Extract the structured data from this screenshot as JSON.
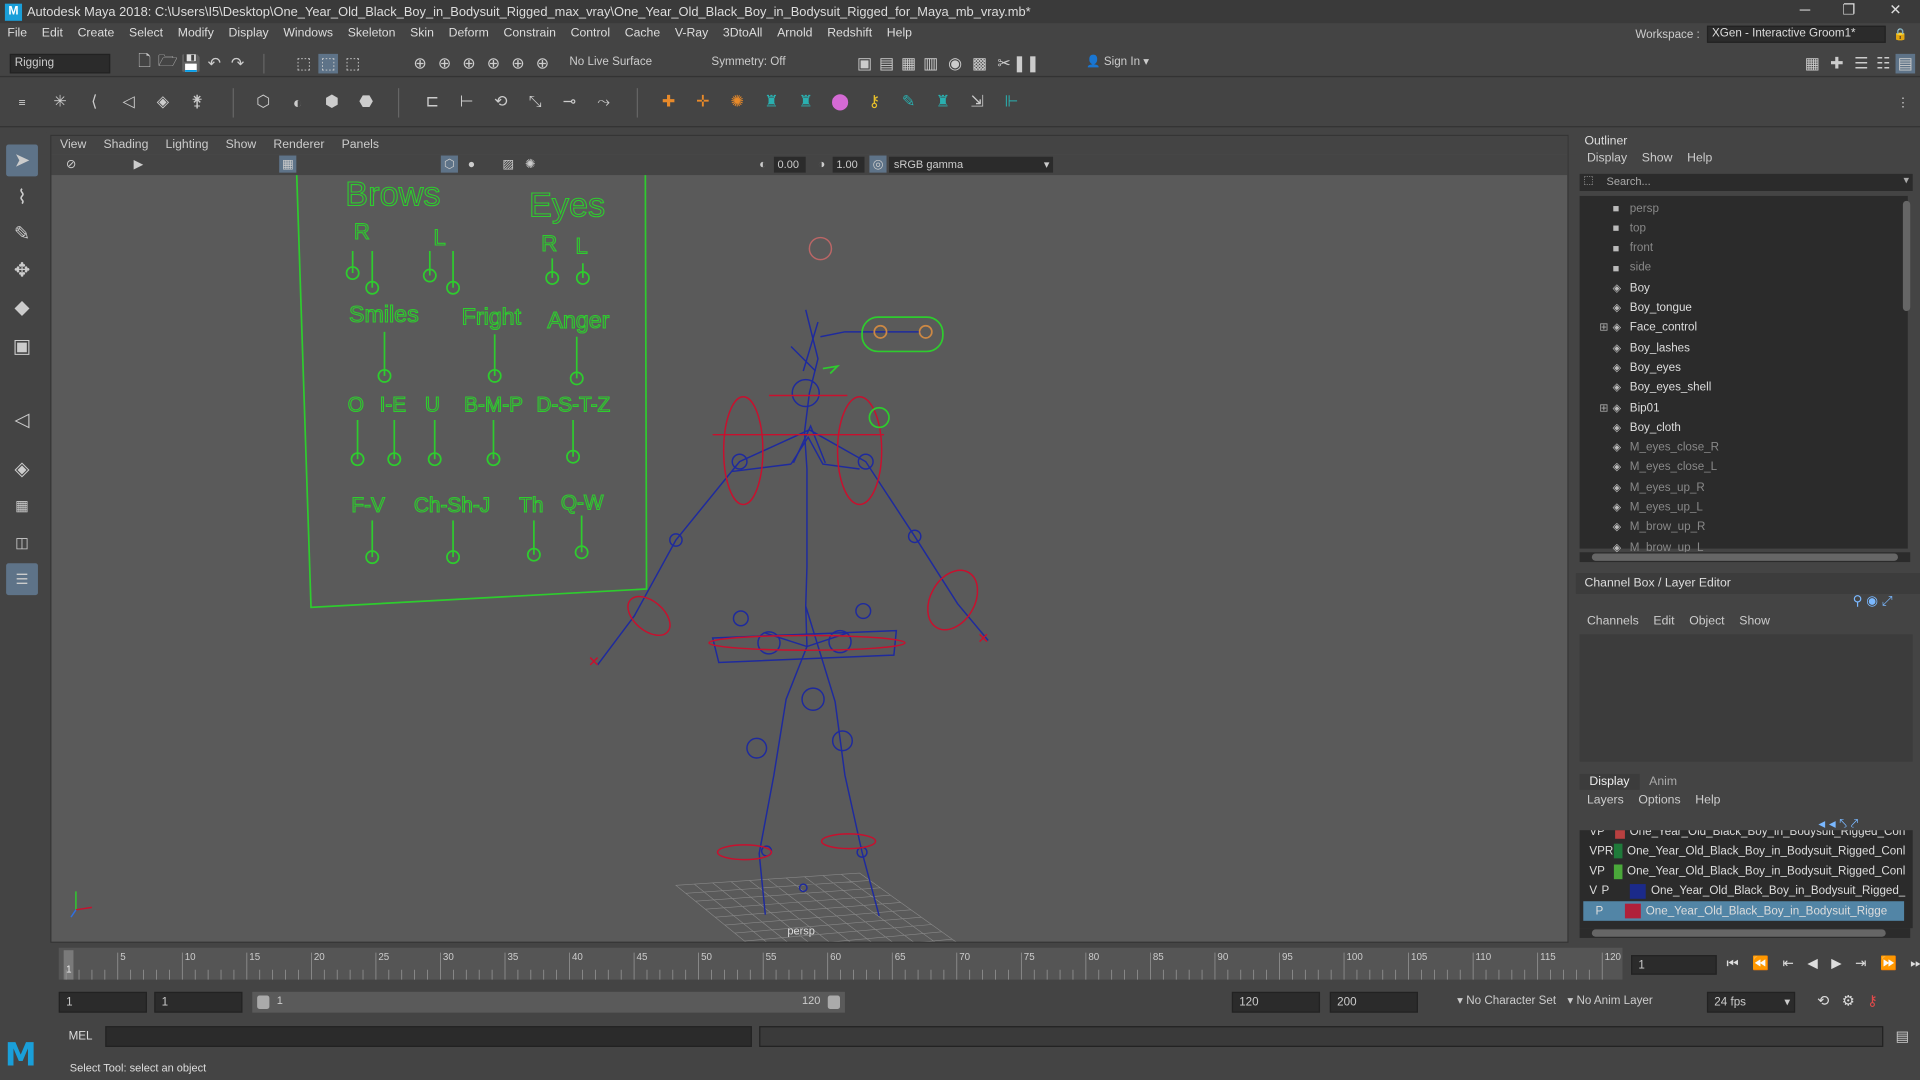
{
  "title": "Autodesk Maya 2018: C:\\Users\\I5\\Desktop\\One_Year_Old_Black_Boy_in_Bodysuit_Rigged_max_vray\\One_Year_Old_Black_Boy_in_Bodysuit_Rigged_for_Maya_mb_vray.mb*",
  "menus": [
    "File",
    "Edit",
    "Create",
    "Select",
    "Modify",
    "Display",
    "Windows",
    "Skeleton",
    "Skin",
    "Deform",
    "Constrain",
    "Control",
    "Cache",
    "V-Ray",
    "3DtoAll",
    "Arnold",
    "Redshift",
    "Help"
  ],
  "workspace": {
    "label": "Workspace :",
    "value": "XGen - Interactive Groom1*"
  },
  "status": {
    "menuset": "Rigging",
    "live": "No Live Surface",
    "symmetry": "Symmetry: Off",
    "signin": "Sign In"
  },
  "viewport": {
    "menus": [
      "View",
      "Shading",
      "Lighting",
      "Show",
      "Renderer",
      "Panels"
    ],
    "exposure": "0.00",
    "gamma": "1.00",
    "colorspace": "sRGB gamma",
    "camera": "persp",
    "board": {
      "brows": "Brows",
      "eyes": "Eyes",
      "r": "R",
      "l": "L",
      "smiles": "Smiles",
      "fright": "Fright",
      "anger": "Anger",
      "o": "O",
      "ie": "I-E",
      "u": "U",
      "bmp": "B-M-P",
      "dstz": "D-S-T-Z",
      "fv": "F-V",
      "chshj": "Ch-Sh-J",
      "th": "Th",
      "qw": "Q-W"
    }
  },
  "outliner": {
    "title": "Outliner",
    "menus": [
      "Display",
      "Show",
      "Help"
    ],
    "search": "Search...",
    "items": [
      {
        "label": "persp",
        "dim": true,
        "cam": true
      },
      {
        "label": "top",
        "dim": true,
        "cam": true
      },
      {
        "label": "front",
        "dim": true,
        "cam": true
      },
      {
        "label": "side",
        "dim": true,
        "cam": true
      },
      {
        "label": "Boy",
        "dim": false
      },
      {
        "label": "Boy_tongue",
        "dim": false
      },
      {
        "label": "Face_control",
        "dim": false,
        "exp": true
      },
      {
        "label": "Boy_lashes",
        "dim": false
      },
      {
        "label": "Boy_eyes",
        "dim": false
      },
      {
        "label": "Boy_eyes_shell",
        "dim": false
      },
      {
        "label": "Bip01",
        "dim": false,
        "exp": true
      },
      {
        "label": "Boy_cloth",
        "dim": false
      },
      {
        "label": "M_eyes_close_R",
        "dim": true
      },
      {
        "label": "M_eyes_close_L",
        "dim": true
      },
      {
        "label": "M_eyes_up_R",
        "dim": true
      },
      {
        "label": "M_eyes_up_L",
        "dim": true
      },
      {
        "label": "M_brow_up_R",
        "dim": true
      },
      {
        "label": "M_brow_up_L",
        "dim": true
      }
    ]
  },
  "channelbox": {
    "title": "Channel Box / Layer Editor",
    "menus": [
      "Channels",
      "Edit",
      "Object",
      "Show"
    ]
  },
  "layers": {
    "tabs": [
      "Display",
      "Anim"
    ],
    "menus": [
      "Layers",
      "Options",
      "Help"
    ],
    "rows": [
      {
        "v": "V",
        "p": "P",
        "r": "",
        "color": "#b84040",
        "name": "One_Year_Old_Black_Boy_in_Bodysuit_Rigged_Con"
      },
      {
        "v": "V",
        "p": "P",
        "r": "R",
        "color": "#1f7a3a",
        "name": "One_Year_Old_Black_Boy_in_Bodysuit_Rigged_Conl"
      },
      {
        "v": "V",
        "p": "P",
        "r": "",
        "color": "#4aa83a",
        "name": "One_Year_Old_Black_Boy_in_Bodysuit_Rigged_Conl"
      },
      {
        "v": "V",
        "p": "P",
        "r": "",
        "color": "#1b2a8a",
        "name": "One_Year_Old_Black_Boy_in_Bodysuit_Rigged_"
      },
      {
        "v": "",
        "p": "P",
        "r": "",
        "color": "#b0203a",
        "name": "One_Year_Old_Black_Boy_in_Bodysuit_Rigge",
        "selected": true
      }
    ]
  },
  "timeline": {
    "ticks": [
      "5",
      "10",
      "15",
      "20",
      "25",
      "30",
      "35",
      "40",
      "45",
      "50",
      "55",
      "60",
      "65",
      "70",
      "75",
      "80",
      "85",
      "90",
      "95",
      "100",
      "105",
      "110",
      "115",
      "120"
    ],
    "start_marker": "1",
    "current": "1"
  },
  "range": {
    "start": "1",
    "start2": "1",
    "slider_start": "1",
    "slider_end": "120",
    "end": "120",
    "end2": "200",
    "charset": "No Character Set",
    "animlayer": "No Anim Layer",
    "fps": "24 fps"
  },
  "cmd": {
    "label": "MEL"
  },
  "help": "Select Tool: select an object"
}
